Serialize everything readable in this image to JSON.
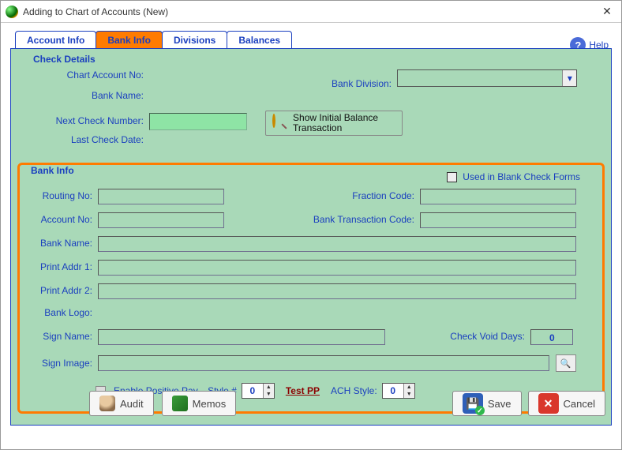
{
  "window": {
    "title": "Adding to Chart of Accounts  (New)"
  },
  "help": {
    "label": "Help"
  },
  "tabs": [
    {
      "label": "Account Info"
    },
    {
      "label": "Bank Info",
      "active": true
    },
    {
      "label": "Divisions"
    },
    {
      "label": "Balances"
    }
  ],
  "check_details": {
    "legend": "Check Details",
    "chart_account_no_label": "Chart Account No:",
    "bank_division_label": "Bank Division:",
    "bank_name_label": "Bank Name:",
    "next_check_number_label": "Next Check Number:",
    "show_initial_balance_label": "Show Initial Balance Transaction",
    "last_check_date_label": "Last Check Date:"
  },
  "bank_info": {
    "legend": "Bank Info",
    "used_blank_forms_label": "Used in Blank Check Forms",
    "routing_no_label": "Routing No:",
    "fraction_code_label": "Fraction Code:",
    "account_no_label": "Account No:",
    "bank_tx_code_label": "Bank Transaction Code:",
    "bank_name_label": "Bank Name:",
    "print_addr1_label": "Print Addr 1:",
    "print_addr2_label": "Print Addr 2:",
    "bank_logo_label": "Bank Logo:",
    "sign_name_label": "Sign Name:",
    "check_void_days_label": "Check Void Days:",
    "check_void_days_value": "0",
    "sign_image_label": "Sign Image:",
    "enable_positive_pay_label": "Enable Positive Pay... Style #",
    "pp_style_value": "0",
    "test_pp_label": "Test PP",
    "ach_style_label": "ACH Style:",
    "ach_style_value": "0"
  },
  "buttons": {
    "audit": "Audit",
    "memos": "Memos",
    "save": "Save",
    "cancel": "Cancel"
  }
}
